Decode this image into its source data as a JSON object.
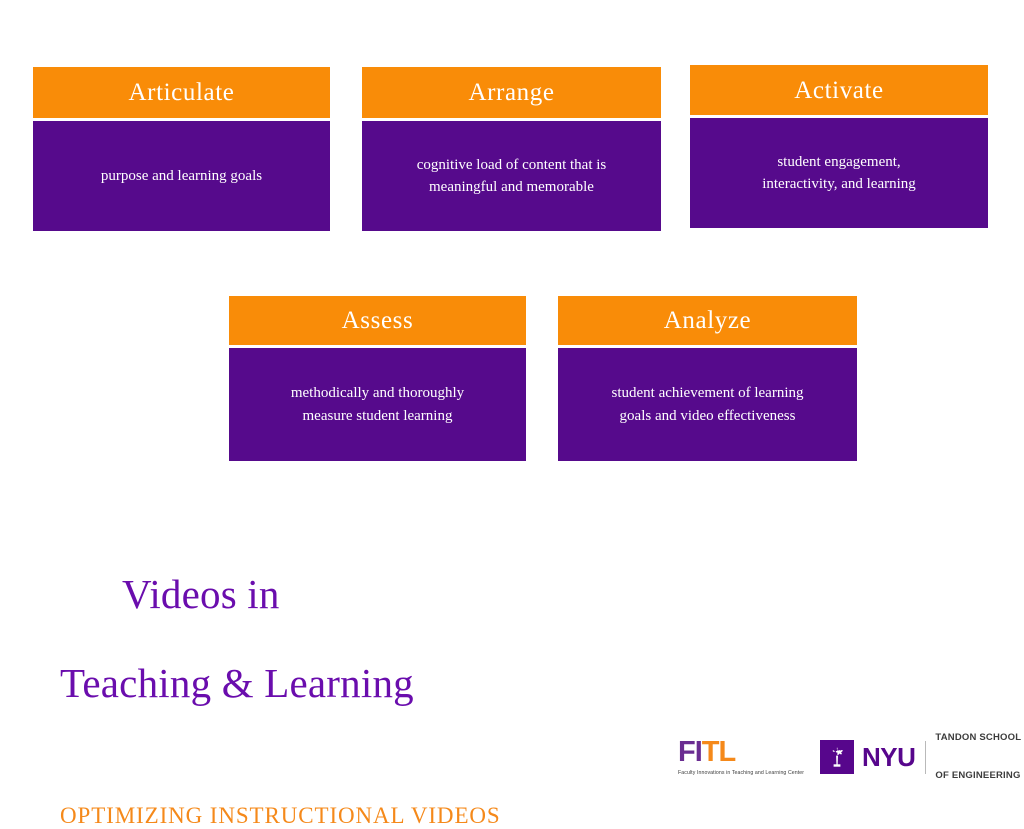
{
  "slide": {
    "background_color": "#ffffff",
    "accent_orange": "#F98C08",
    "accent_purple": "#560A8C",
    "title_purple": "#6A0DAD",
    "subtitle_orange": "#F5891A"
  },
  "cards": {
    "row1": [
      {
        "id": "articulate",
        "heading": "Articulate",
        "body_lines": [
          "purpose and learning goals"
        ]
      },
      {
        "id": "arrange",
        "heading": "Arrange",
        "body_lines": [
          "cognitive load of content that is",
          "meaningful and memorable"
        ]
      },
      {
        "id": "activate",
        "heading": "Activate",
        "body_lines": [
          "student engagement,",
          "interactivity, and learning"
        ]
      }
    ],
    "row2": [
      {
        "id": "assess",
        "heading": "Assess",
        "body_lines": [
          "methodically and thoroughly",
          "measure student learning"
        ]
      },
      {
        "id": "analyze",
        "heading": "Analyze",
        "body_lines": [
          "student achievement of learning",
          "goals and video effectiveness"
        ]
      }
    ]
  },
  "title_block": {
    "title_line1": "Videos in",
    "title_line2": "Teaching & Learning",
    "subtitle": "OPTIMIZING INSTRUCTIONAL VIDEOS"
  },
  "logos": {
    "fitl": {
      "f": "F",
      "i": "I",
      "t": "T",
      "l": "L",
      "tagline": "Faculty Innovations in Teaching and Learning Center"
    },
    "nyu": {
      "mark_icon": "torch-icon",
      "wordmark": "NYU",
      "school_line1": "TANDON SCHOOL",
      "school_line2": "OF ENGINEERING"
    }
  }
}
